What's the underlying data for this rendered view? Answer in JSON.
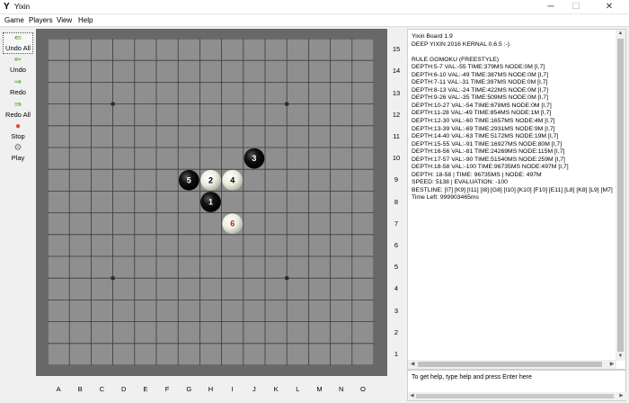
{
  "window": {
    "title": "Yixin",
    "icon": "Y",
    "minimize_glyph": "─",
    "maximize_glyph": "☐",
    "close_glyph": "✕"
  },
  "menu": [
    "Game",
    "Players",
    "View",
    "Help"
  ],
  "toolbar": [
    {
      "label": "Undo All",
      "icon": "⇚",
      "color": "#5aa52c",
      "focused": true
    },
    {
      "label": "Undo",
      "icon": "⇐",
      "color": "#5aa52c"
    },
    {
      "label": "Redo",
      "icon": "⇒",
      "color": "#5aa52c"
    },
    {
      "label": "Redo All",
      "icon": "⇛",
      "color": "#5aa52c"
    },
    {
      "label": "Stop",
      "icon": "●",
      "color": "#e0463e"
    },
    {
      "label": "Play",
      "icon": "⚙",
      "color": "#7a7a7a"
    }
  ],
  "board": {
    "size": 15,
    "columns": [
      "A",
      "B",
      "C",
      "D",
      "E",
      "F",
      "G",
      "H",
      "I",
      "J",
      "K",
      "L",
      "M",
      "N",
      "O"
    ],
    "rows": [
      "15",
      "14",
      "13",
      "12",
      "11",
      "10",
      "9",
      "8",
      "7",
      "6",
      "5",
      "4",
      "3",
      "2",
      "1"
    ],
    "star_points": [
      [
        "D",
        "12"
      ],
      [
        "L",
        "12"
      ],
      [
        "D",
        "4"
      ],
      [
        "L",
        "4"
      ]
    ],
    "stones": [
      {
        "move": "1",
        "color": "black",
        "col": "H",
        "row": "8"
      },
      {
        "move": "2",
        "color": "white",
        "col": "H",
        "row": "9"
      },
      {
        "move": "3",
        "color": "black",
        "col": "J",
        "row": "10"
      },
      {
        "move": "4",
        "color": "white",
        "col": "I",
        "row": "9"
      },
      {
        "move": "5",
        "color": "black",
        "col": "G",
        "row": "9"
      },
      {
        "move": "6",
        "color": "white",
        "col": "I",
        "row": "7",
        "last": true
      }
    ],
    "colors": {
      "frame": "#686868",
      "surface": "#8f8f8f",
      "grid": "#3a3a3a",
      "last_move_number": "#d01c1c"
    }
  },
  "log": [
    "Yixin Board 1.9",
    "DEEP YIXIN 2016 KERNAL 0.6.5 :-)",
    "",
    "RULE GOMOKU (FREESTYLE)",
    "DEPTH:5-7 VAL:-55 TIME:379MS NODE:0M [I,7]",
    "DEPTH:6-10 VAL:-49 TIME:387MS NODE:0M [I,7]",
    "DEPTH:7-11 VAL:-31 TIME:397MS NODE:0M [I,7]",
    "DEPTH:8-13 VAL:-24 TIME:422MS NODE:0M [I,7]",
    "DEPTH:9-26 VAL:-35 TIME:509MS NODE:0M [I,7]",
    "DEPTH:10-27 VAL:-54 TIME:678MS NODE:0M [I,7]",
    "DEPTH:11-28 VAL:-49 TIME:854MS NODE:1M [I,7]",
    "DEPTH:12-30 VAL:-60 TIME:1657MS NODE:4M [I,7]",
    "DEPTH:13-39 VAL:-69 TIME:2931MS NODE:9M [I,7]",
    "DEPTH:14-40 VAL:-63 TIME:5172MS NODE:19M [I,7]",
    "DEPTH:15-55 VAL:-91 TIME:16927MS NODE:80M [I,7]",
    "DEPTH:16-56 VAL:-81 TIME:24269MS NODE:115M [I,7]",
    "DEPTH:17-57 VAL:-90 TIME:51540MS NODE:259M [I,7]",
    "DEPTH:18-58 VAL:-100 TIME:96735MS NODE:497M [I,7]",
    "DEPTH: 18-58 | TIME: 96735MS | NODE: 497M",
    "SPEED: 5138 | EVALUATION: -100",
    "BESTLINE: [I7] [K9] [I11] [I8] [G8] [I10] [K10] [F10] [E11] [L8] [K8] [L9] [M7]",
    "Time Left: 999903465ms"
  ],
  "command": {
    "hint": "To get help, type help and press Enter here"
  }
}
